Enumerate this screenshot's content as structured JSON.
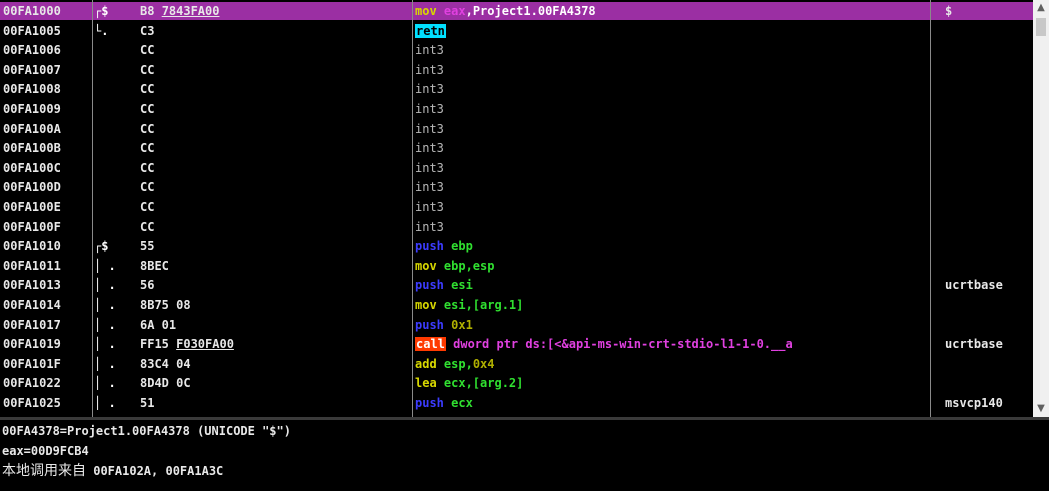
{
  "disasm": {
    "rows": [
      {
        "addr": "00FA1000",
        "tree": "┌$",
        "bytes": "B8 7843FA00",
        "bytes_underline": "7843FA00",
        "asm": [
          {
            "t": "mov ",
            "c": "tok-op"
          },
          {
            "t": "eax",
            "c": "tok-mag"
          },
          {
            "t": ",Project1.00FA4378",
            "c": "tok-white"
          }
        ],
        "comment": "$",
        "selected": true
      },
      {
        "addr": "00FA1005",
        "tree": "└.",
        "bytes": "C3",
        "asm": [
          {
            "t": "retn",
            "c": "tok-retn"
          }
        ],
        "comment": ""
      },
      {
        "addr": "00FA1006",
        "tree": "",
        "bytes": "CC",
        "asm": [
          {
            "t": "int3",
            "c": "tok-int3"
          }
        ],
        "comment": ""
      },
      {
        "addr": "00FA1007",
        "tree": "",
        "bytes": "CC",
        "asm": [
          {
            "t": "int3",
            "c": "tok-int3"
          }
        ],
        "comment": ""
      },
      {
        "addr": "00FA1008",
        "tree": "",
        "bytes": "CC",
        "asm": [
          {
            "t": "int3",
            "c": "tok-int3"
          }
        ],
        "comment": ""
      },
      {
        "addr": "00FA1009",
        "tree": "",
        "bytes": "CC",
        "asm": [
          {
            "t": "int3",
            "c": "tok-int3"
          }
        ],
        "comment": ""
      },
      {
        "addr": "00FA100A",
        "tree": "",
        "bytes": "CC",
        "asm": [
          {
            "t": "int3",
            "c": "tok-int3"
          }
        ],
        "comment": ""
      },
      {
        "addr": "00FA100B",
        "tree": "",
        "bytes": "CC",
        "asm": [
          {
            "t": "int3",
            "c": "tok-int3"
          }
        ],
        "comment": ""
      },
      {
        "addr": "00FA100C",
        "tree": "",
        "bytes": "CC",
        "asm": [
          {
            "t": "int3",
            "c": "tok-int3"
          }
        ],
        "comment": ""
      },
      {
        "addr": "00FA100D",
        "tree": "",
        "bytes": "CC",
        "asm": [
          {
            "t": "int3",
            "c": "tok-int3"
          }
        ],
        "comment": ""
      },
      {
        "addr": "00FA100E",
        "tree": "",
        "bytes": "CC",
        "asm": [
          {
            "t": "int3",
            "c": "tok-int3"
          }
        ],
        "comment": ""
      },
      {
        "addr": "00FA100F",
        "tree": "",
        "bytes": "CC",
        "asm": [
          {
            "t": "int3",
            "c": "tok-int3"
          }
        ],
        "comment": ""
      },
      {
        "addr": "00FA1010",
        "tree": "┌$",
        "bytes": "55",
        "asm": [
          {
            "t": "push ",
            "c": "tok-push"
          },
          {
            "t": "ebp",
            "c": "tok-green"
          }
        ],
        "comment": ""
      },
      {
        "addr": "00FA1011",
        "tree": "│ .",
        "bytes": "8BEC",
        "asm": [
          {
            "t": "mov ",
            "c": "tok-op"
          },
          {
            "t": "ebp,esp",
            "c": "tok-green"
          }
        ],
        "comment": ""
      },
      {
        "addr": "00FA1013",
        "tree": "│ .",
        "bytes": "56",
        "asm": [
          {
            "t": "push ",
            "c": "tok-push"
          },
          {
            "t": "esi",
            "c": "tok-green"
          }
        ],
        "comment": "ucrtbase"
      },
      {
        "addr": "00FA1014",
        "tree": "│ .",
        "bytes": "8B75 08",
        "asm": [
          {
            "t": "mov ",
            "c": "tok-op"
          },
          {
            "t": "esi,[arg.1]",
            "c": "tok-green"
          }
        ],
        "comment": ""
      },
      {
        "addr": "00FA1017",
        "tree": "│ .",
        "bytes": "6A 01",
        "asm": [
          {
            "t": "push ",
            "c": "tok-push"
          },
          {
            "t": "0x1",
            "c": "tok-num"
          }
        ],
        "comment": ""
      },
      {
        "addr": "00FA1019",
        "tree": "│ .",
        "bytes": "FF15 F030FA00",
        "bytes_underline": "F030FA00",
        "asm": [
          {
            "t": "call",
            "c": "tok-call"
          },
          {
            "t": " dword ptr ds:[<&api-ms-win-crt-stdio-l1-1-0.__a",
            "c": "tok-mag"
          }
        ],
        "comment": "ucrtbase"
      },
      {
        "addr": "00FA101F",
        "tree": "│ .",
        "bytes": "83C4 04",
        "asm": [
          {
            "t": "add ",
            "c": "tok-op"
          },
          {
            "t": "esp,",
            "c": "tok-green"
          },
          {
            "t": "0x4",
            "c": "tok-num"
          }
        ],
        "comment": ""
      },
      {
        "addr": "00FA1022",
        "tree": "│ .",
        "bytes": "8D4D 0C",
        "asm": [
          {
            "t": "lea ",
            "c": "tok-op"
          },
          {
            "t": "ecx,[arg.2]",
            "c": "tok-green"
          }
        ],
        "comment": ""
      },
      {
        "addr": "00FA1025",
        "tree": "│ .",
        "bytes": "51",
        "asm": [
          {
            "t": "push ",
            "c": "tok-push"
          },
          {
            "t": "ecx",
            "c": "tok-green"
          }
        ],
        "comment": "msvcp140"
      }
    ]
  },
  "info": {
    "line1": "00FA4378=Project1.00FA4378 (UNICODE \"$\")",
    "line2": "eax=00D9FCB4",
    "line3_label": "本地调用来自",
    "line3_value": " 00FA102A, 00FA1A3C"
  },
  "scrollbar": {
    "up_icon": "▲",
    "down_icon": "▼"
  },
  "colors": {
    "selection": "#9b2fa3",
    "background": "#000000",
    "retn_bg": "#00e0ff",
    "call_bg": "#ff3a00"
  }
}
